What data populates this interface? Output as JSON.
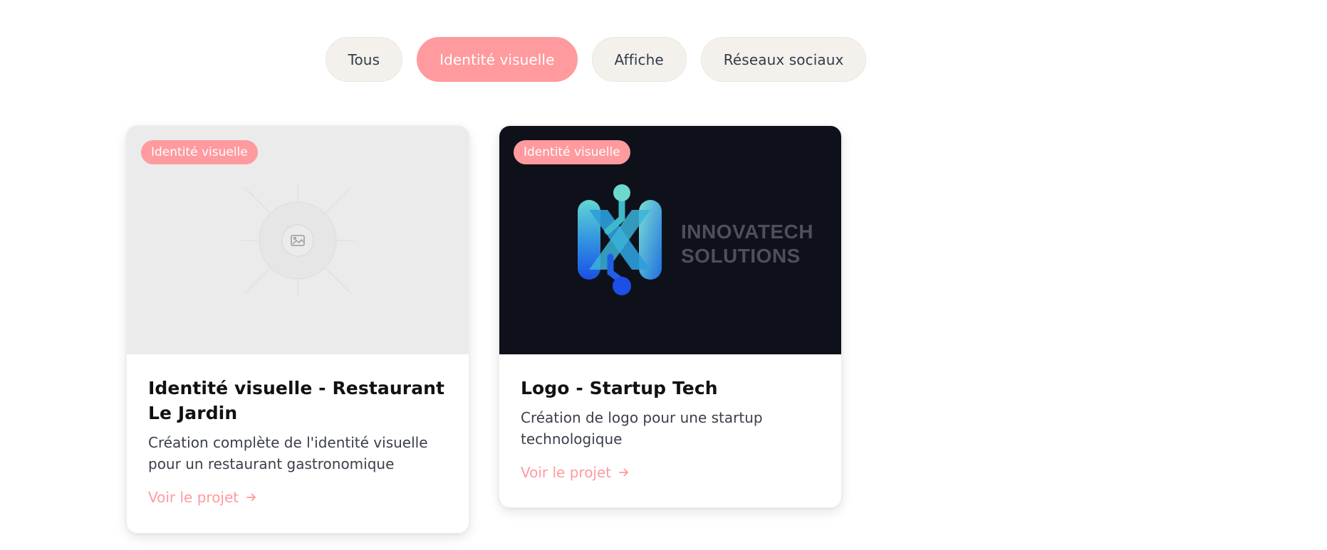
{
  "filters": {
    "items": [
      {
        "label": "Tous"
      },
      {
        "label": "Identité visuelle"
      },
      {
        "label": "Affiche"
      },
      {
        "label": "Réseaux sociaux"
      }
    ],
    "active": "Identité visuelle"
  },
  "projects": [
    {
      "badge": "Identité visuelle",
      "image": "image-placeholder-icon",
      "title": "Identité visuelle - Restaurant Le Jardin",
      "description": "Création complète de l'identité visuelle pour un restaurant gastronomique",
      "link": "Voir le projet",
      "link_icon": "arrow-right-icon"
    },
    {
      "badge": "Identité visuelle",
      "image": "innovatech-logo",
      "brand_line_1": "INNOVATECH",
      "brand_line_2": "SOLUTIONS",
      "title": "Logo - Startup Tech",
      "description": "Création de logo pour une startup technologique",
      "link": "Voir le projet",
      "link_icon": "arrow-right-icon"
    }
  ],
  "colors": {
    "accent": "#ff9a9e",
    "chip_bg": "#f4f1ec",
    "dark_thumb": "#0e1119"
  }
}
